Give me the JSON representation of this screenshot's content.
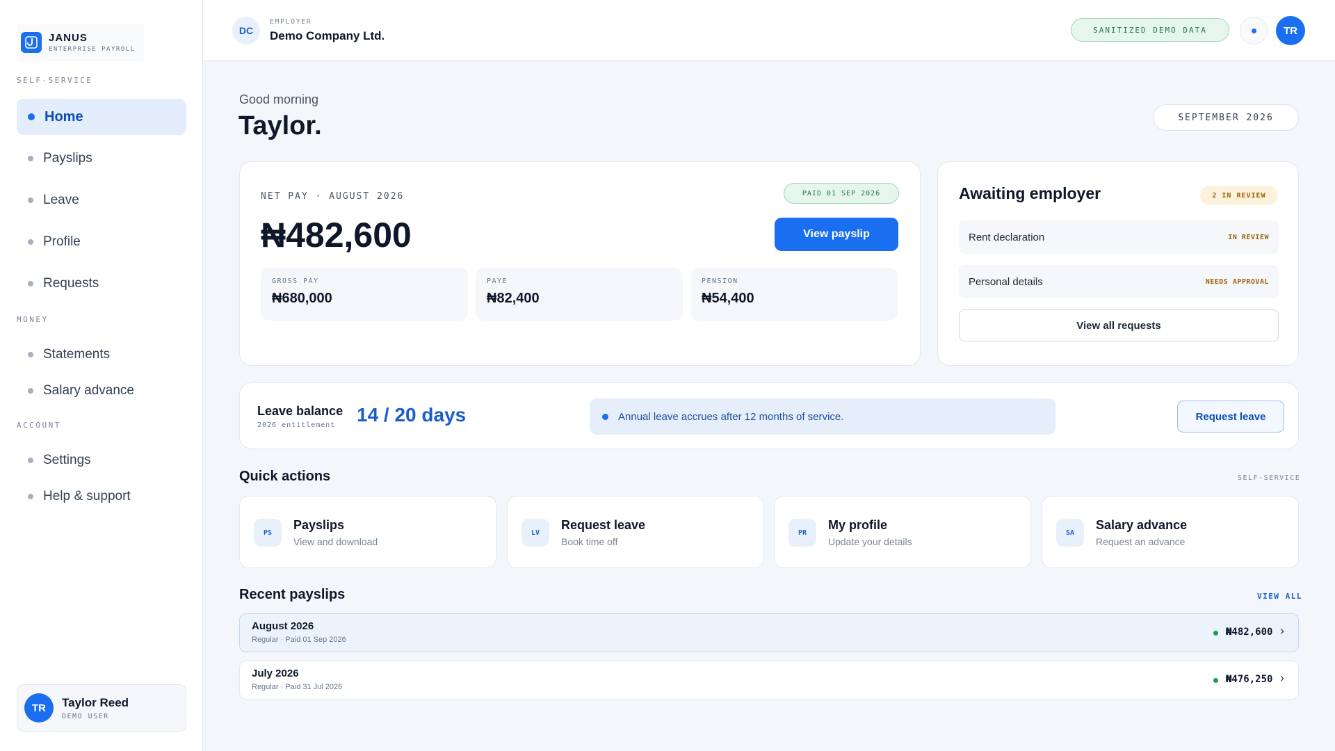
{
  "brand": {
    "name": "JANUS",
    "subtitle": "ENTERPRISE PAYROLL",
    "logo_icon": "hook-icon"
  },
  "sidebar": {
    "sections": {
      "self_service": "SELF-SERVICE",
      "money": "MONEY",
      "account": "ACCOUNT"
    },
    "items": {
      "home": "Home",
      "payslips": "Payslips",
      "leave": "Leave",
      "profile": "Profile",
      "requests": "Requests",
      "statements": "Statements",
      "salary_advance": "Salary advance",
      "settings": "Settings",
      "help": "Help & support"
    },
    "active_item": "Home",
    "user": {
      "initials": "TR",
      "name": "Taylor Reed",
      "role": "DEMO USER"
    }
  },
  "header": {
    "employer_initials": "DC",
    "employer_label": "EMPLOYER",
    "employer_name": "Demo Company Ltd.",
    "demo_badge": "SANITIZED DEMO DATA",
    "user_initials": "TR"
  },
  "greeting": {
    "salutation": "Good morning",
    "name": "Taylor.",
    "period": "SEPTEMBER 2026"
  },
  "net_pay": {
    "label": "NET PAY · AUGUST 2026",
    "status": "PAID 01 SEP 2026",
    "amount": "₦482,600",
    "button": "View payslip",
    "stats": {
      "gross": {
        "label": "GROSS PAY",
        "value": "₦680,000"
      },
      "paye": {
        "label": "PAYE",
        "value": "₦82,400"
      },
      "pension": {
        "label": "PENSION",
        "value": "₦54,400"
      }
    }
  },
  "awaiting": {
    "title": "Awaiting employer",
    "badge": "2 IN REVIEW",
    "rows": {
      "rent": {
        "title": "Rent declaration",
        "status": "IN REVIEW"
      },
      "personal": {
        "title": "Personal details",
        "status": "NEEDS APPROVAL"
      }
    },
    "button": "View all requests"
  },
  "leave": {
    "title": "Leave balance",
    "subtitle": "2026 entitlement",
    "days": "14 / 20 days",
    "info": "Annual leave accrues after 12 months of service.",
    "button": "Request leave"
  },
  "quick_actions": {
    "title": "Quick actions",
    "tag": "SELF-SERVICE",
    "items": {
      "payslips": {
        "icon": "PS",
        "name": "Payslips",
        "desc": "View and download"
      },
      "leave": {
        "icon": "LV",
        "name": "Request leave",
        "desc": "Book time off"
      },
      "profile": {
        "icon": "PR",
        "name": "My profile",
        "desc": "Update your details"
      },
      "advance": {
        "icon": "SA",
        "name": "Salary advance",
        "desc": "Request an advance"
      }
    }
  },
  "recent_payslips": {
    "title": "Recent payslips",
    "view_all": "VIEW ALL",
    "rows": {
      "aug": {
        "month": "August 2026",
        "meta": "Regular · Paid 01 Sep 2026",
        "amount": "₦482,600"
      },
      "jul": {
        "month": "July 2026",
        "meta": "Regular · Paid 31 Jul 2026",
        "amount": "₦476,250"
      }
    }
  },
  "colors": {
    "accent": "#1a6ef0",
    "success": "#1d7a45",
    "warning": "#9a6107",
    "background": "#f3f6fa"
  }
}
